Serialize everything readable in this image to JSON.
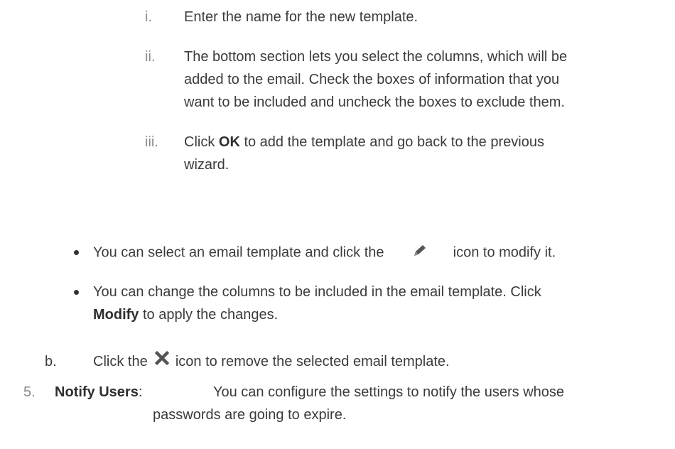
{
  "steps": [
    {
      "marker": "i.",
      "lines": [
        "Enter the name for the new template."
      ]
    },
    {
      "marker": "ii.",
      "lines": [
        "The bottom section lets you select the columns, which will be",
        "added to the email. Check the boxes of information that you",
        "want to be included and uncheck the boxes to exclude them."
      ]
    },
    {
      "marker": "iii.",
      "pre": "Click ",
      "bold": "OK",
      "post": " to add the template and go back to the previous",
      "line2": "wizard."
    }
  ],
  "bullets": [
    {
      "pre": "You can select an email template and click the",
      "icon": "pencil-icon",
      "post": "icon to modify it."
    },
    {
      "line1": "You can change the columns to be included in the email template. Click",
      "bold": "Modify",
      "post": " to apply the changes."
    }
  ],
  "item_b": {
    "marker": "b.",
    "pre": "Click the",
    "icon": "close-x-icon",
    "post": "icon to remove the selected email template."
  },
  "item_5": {
    "marker": "5.",
    "bold": "Notify Users",
    "colon": ":",
    "line1": "You can configure the settings to notify the users whose",
    "line2": "passwords are going to expire."
  }
}
